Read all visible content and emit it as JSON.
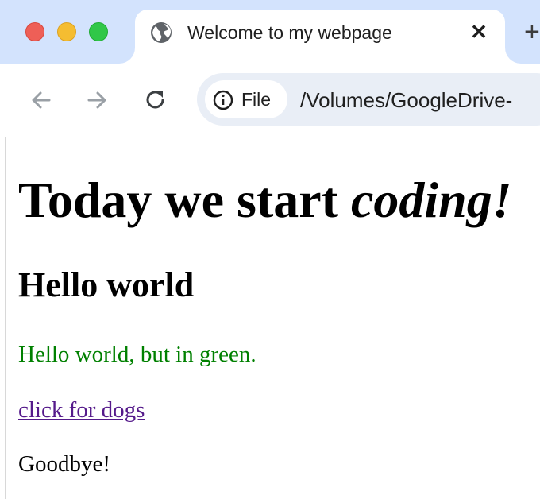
{
  "browser": {
    "tab": {
      "title": "Welcome to my webpage",
      "close_label": "✕",
      "icon": "globe-icon"
    },
    "new_tab_label": "+",
    "toolbar": {
      "back_icon": "back-arrow-icon",
      "forward_icon": "forward-arrow-icon",
      "reload_icon": "reload-icon"
    },
    "address_bar": {
      "chip_label": "File",
      "chip_icon": "info-icon",
      "url": "/Volumes/GoogleDrive-"
    },
    "colors": {
      "tabstrip": "#d3e3fd",
      "omnibox": "#e9eef6",
      "close": "#ee5f57",
      "minimize": "#f5bd31",
      "maximize": "#30c748"
    }
  },
  "page": {
    "heading_plain": "Today we start ",
    "heading_italic": "coding!",
    "subheading": "Hello world",
    "green_text": "Hello world, but in green.",
    "link_text": "click for dogs",
    "goodbye": "Goodbye!",
    "colors": {
      "green_text": "#008000",
      "link": "#551a8b"
    }
  }
}
